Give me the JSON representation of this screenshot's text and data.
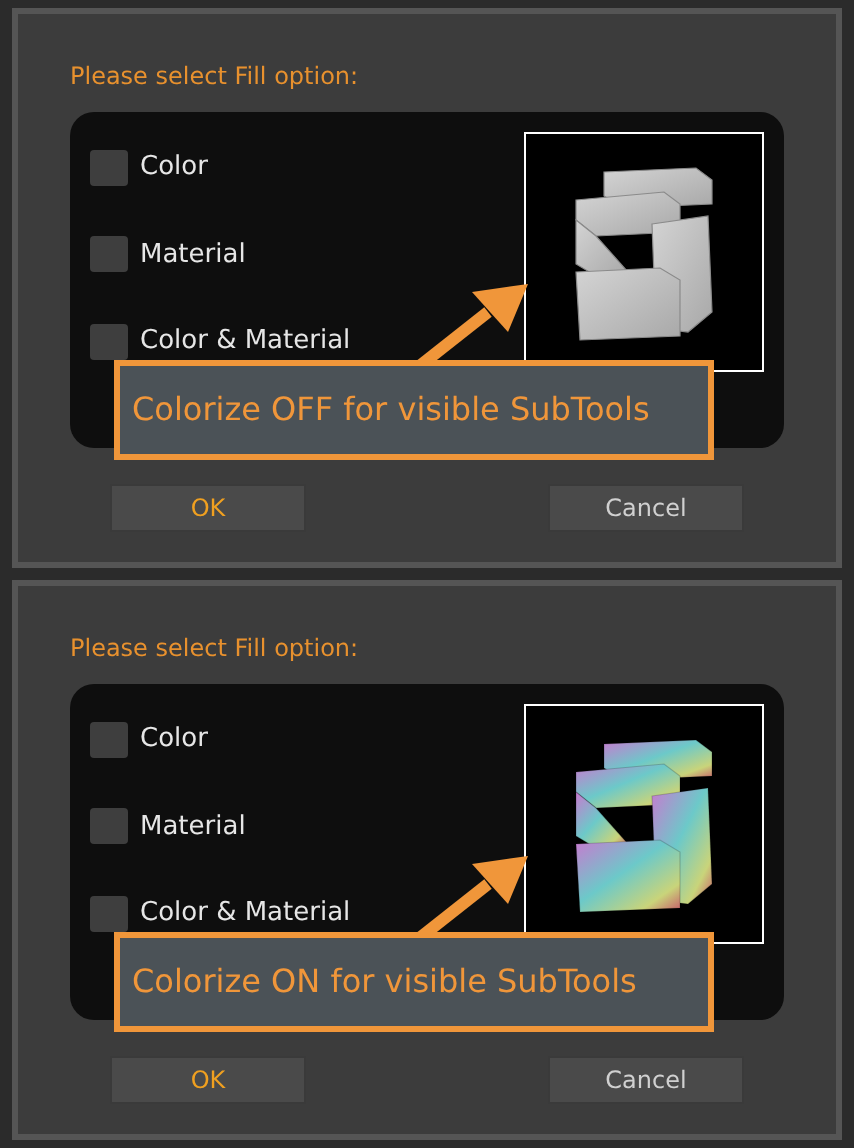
{
  "dialogs": [
    {
      "prompt": "Please select Fill option:",
      "options": [
        {
          "label": "Color",
          "checked": false
        },
        {
          "label": "Material",
          "checked": false
        },
        {
          "label": "Color & Material",
          "checked": false
        }
      ],
      "preview": {
        "colorized": false
      },
      "callout": "Colorize OFF for visible SubTools",
      "buttons": [
        {
          "label": "OK",
          "kind": "primary"
        },
        {
          "label": "Cancel",
          "kind": "secondary"
        }
      ]
    },
    {
      "prompt": "Please select Fill option:",
      "options": [
        {
          "label": "Color",
          "checked": false
        },
        {
          "label": "Material",
          "checked": false
        },
        {
          "label": "Color & Material",
          "checked": false
        }
      ],
      "preview": {
        "colorized": true
      },
      "callout": "Colorize ON for visible SubTools",
      "buttons": [
        {
          "label": "OK",
          "kind": "primary"
        },
        {
          "label": "Cancel",
          "kind": "secondary"
        }
      ]
    }
  ]
}
